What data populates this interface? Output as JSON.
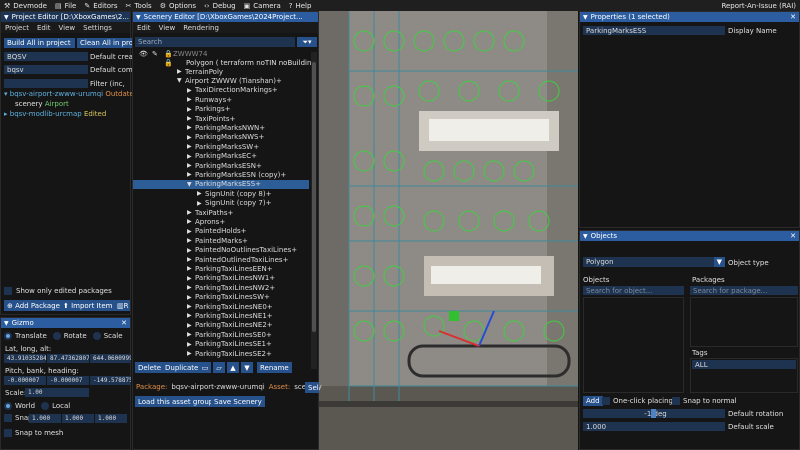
{
  "menubar": {
    "items": [
      {
        "label": "Devmode",
        "icon": "devmode-icon",
        "glyph": "⚒"
      },
      {
        "label": "File",
        "icon": "file-icon",
        "glyph": "▤"
      },
      {
        "label": "Editors",
        "icon": "editors-icon",
        "glyph": "✎"
      },
      {
        "label": "Tools",
        "icon": "tools-icon",
        "glyph": "✂"
      },
      {
        "label": "Options",
        "icon": "options-gear-icon",
        "glyph": "⚙"
      },
      {
        "label": "Debug",
        "icon": "debug-icon",
        "glyph": "‹›"
      },
      {
        "label": "Camera",
        "icon": "camera-icon",
        "glyph": "▣"
      },
      {
        "label": "Help",
        "icon": "help-icon",
        "glyph": "?"
      }
    ],
    "report": "Report-An-Issue (RAI)"
  },
  "project_editor": {
    "title": "Project Editor [D:\\XboxGames\\2...",
    "menu": [
      "Project",
      "Edit",
      "View",
      "Settings"
    ],
    "build_all": "Build All in project",
    "clean_all": "Clean All in pro",
    "fields": [
      {
        "value": "BQSV",
        "label": "Default crea"
      },
      {
        "value": "bqsv",
        "label": "Default comp"
      },
      {
        "value": "",
        "label": "Filter (inc,"
      }
    ],
    "tree": [
      {
        "name": "bqsv-airport-zwww-urumqi",
        "status": "Outdated",
        "expanded": true
      },
      {
        "name": "scenery",
        "status": "Airport",
        "child": true
      },
      {
        "name": "bqsv-modlib-urcmap",
        "status": "Edited",
        "expanded": false
      }
    ],
    "show_only_edited": "Show only edited packages",
    "add_package": "Add Package",
    "import_item": "Import Item",
    "r_button": "R"
  },
  "gizmo": {
    "title": "Gizmo",
    "modes": [
      "Translate",
      "Rotate",
      "Scale"
    ],
    "latlong_label": "Lat, long, alt:",
    "latlong": [
      "43.910352842",
      "87.473628070",
      "644.060099908"
    ],
    "pbh_label": "Pitch, bank, heading:",
    "pbh": [
      "-0.000007",
      "-0.000007",
      "-149.578875"
    ],
    "scale_label": "Scale:",
    "scale": "1.00",
    "space": [
      "World",
      "Local"
    ],
    "snap_label": "Snap",
    "snap": [
      "1.000",
      "1.000",
      "1.000"
    ],
    "snap_to_mesh": "Snap to mesh"
  },
  "scenery_editor": {
    "title": "Scenery Editor [D:\\XboxGames\\2024Project...",
    "menu": [
      "Edit",
      "View",
      "Rendering"
    ],
    "search_placeholder": "Search",
    "group_label": "ZWWW74",
    "root": "Polygon  ( terraform noTIN noBuilding",
    "rows": [
      {
        "label": "TerrainPoly",
        "indent": 1,
        "arrow": "▶"
      },
      {
        "label": "Airport ZWWW (Tianshan)+",
        "indent": 1,
        "arrow": "▼"
      },
      {
        "label": "TaxiDirectionMarkings+",
        "indent": 2,
        "arrow": "▶"
      },
      {
        "label": "Runways+",
        "indent": 2,
        "arrow": "▶"
      },
      {
        "label": "Parkings+",
        "indent": 2,
        "arrow": "▶"
      },
      {
        "label": "TaxiPoints+",
        "indent": 2,
        "arrow": "▶"
      },
      {
        "label": "ParkingMarksNWN+",
        "indent": 2,
        "arrow": "▶"
      },
      {
        "label": "ParkingMarksNWS+",
        "indent": 2,
        "arrow": "▶"
      },
      {
        "label": "ParkingMarksSW+",
        "indent": 2,
        "arrow": "▶"
      },
      {
        "label": "ParkingMarksEC+",
        "indent": 2,
        "arrow": "▶"
      },
      {
        "label": "ParkingMarksESN+",
        "indent": 2,
        "arrow": "▶"
      },
      {
        "label": "ParkingMarksESN (copy)+",
        "indent": 2,
        "arrow": "▶"
      },
      {
        "label": "ParkingMarksESS+",
        "indent": 2,
        "arrow": "▼",
        "selected": true
      },
      {
        "label": "SignUnit (copy 8)+",
        "indent": 3,
        "arrow": "▶"
      },
      {
        "label": "SignUnit (copy 7)+",
        "indent": 3,
        "arrow": "▶"
      },
      {
        "label": "TaxiPaths+",
        "indent": 2,
        "arrow": "▶"
      },
      {
        "label": "Aprons+",
        "indent": 2,
        "arrow": "▶"
      },
      {
        "label": "PaintedHolds+",
        "indent": 2,
        "arrow": "▶"
      },
      {
        "label": "PaintedMarks+",
        "indent": 2,
        "arrow": "▶"
      },
      {
        "label": "PaintedNoOutlinesTaxiLines+",
        "indent": 2,
        "arrow": "▶"
      },
      {
        "label": "PaintedOutlinedTaxiLines+",
        "indent": 2,
        "arrow": "▶"
      },
      {
        "label": "ParkingTaxiLinesEEN+",
        "indent": 2,
        "arrow": "▶"
      },
      {
        "label": "ParkingTaxiLinesNW1+",
        "indent": 2,
        "arrow": "▶"
      },
      {
        "label": "ParkingTaxiLinesNW2+",
        "indent": 2,
        "arrow": "▶"
      },
      {
        "label": "ParkingTaxiLinesSW+",
        "indent": 2,
        "arrow": "▶"
      },
      {
        "label": "ParkingTaxiLinesNE0+",
        "indent": 2,
        "arrow": "▶"
      },
      {
        "label": "ParkingTaxiLinesNE1+",
        "indent": 2,
        "arrow": "▶"
      },
      {
        "label": "ParkingTaxiLinesNE2+",
        "indent": 2,
        "arrow": "▶"
      },
      {
        "label": "ParkingTaxiLinesSE0+",
        "indent": 2,
        "arrow": "▶"
      },
      {
        "label": "ParkingTaxiLinesSE1+",
        "indent": 2,
        "arrow": "▶"
      },
      {
        "label": "ParkingTaxiLinesSE2+",
        "indent": 2,
        "arrow": "▶"
      }
    ],
    "delete": "Delete",
    "duplicate": "Duplicate",
    "rename": "Rename",
    "package_label": "Package:",
    "package_value": "bqsv-airport-zwww-urumqi",
    "asset_label": "Asset:",
    "asset_value": "scenery",
    "select_button": "Sele",
    "load_group": "Load this asset group",
    "save_scenery": "Save Scenery"
  },
  "properties": {
    "title": "Properties (1 selected)",
    "value": "ParkingMarksESS",
    "label": "Display Name"
  },
  "objects": {
    "title": "Objects",
    "type_value": "Polygon",
    "type_label": "Object type",
    "objects_label": "Objects",
    "packages_label": "Packages",
    "search_objects": "Search for object...",
    "search_packages": "Search for package...",
    "tags_label": "Tags",
    "tags_value": "ALL",
    "add": "Add",
    "one_click": "One-click placing",
    "snap_normal": "Snap to normal",
    "rotation_value": "-1 deg",
    "rotation_label": "Default rotation",
    "scale_value": "1.000",
    "scale_label": "Default scale"
  },
  "colors": {
    "accent": "#2b5da0",
    "field": "#1e3350",
    "green_marks": "#4fd24f"
  }
}
